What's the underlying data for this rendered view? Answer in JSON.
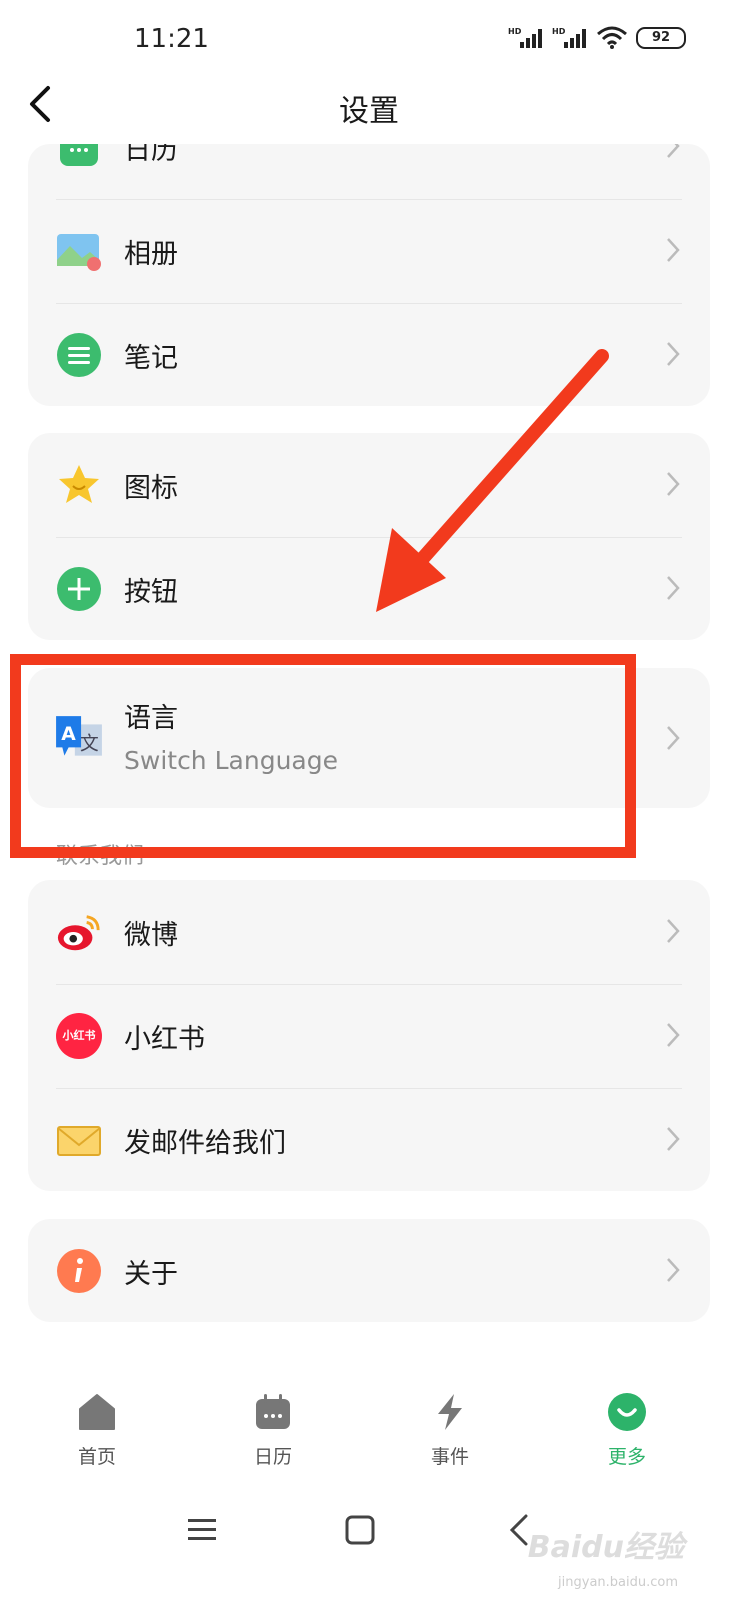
{
  "status_bar": {
    "time": "11:21",
    "signal_label_1": "HD",
    "signal_label_2": "HD",
    "battery": "92"
  },
  "header": {
    "title": "设置"
  },
  "section1": {
    "items": [
      {
        "label": "日历",
        "icon": "calendar-app-icon"
      },
      {
        "label": "相册",
        "icon": "photo-album-icon"
      },
      {
        "label": "笔记",
        "icon": "notes-icon"
      }
    ]
  },
  "section2": {
    "items": [
      {
        "label": "图标",
        "icon": "star-icon"
      },
      {
        "label": "按钮",
        "icon": "plus-circle-icon"
      }
    ]
  },
  "language": {
    "title": "语言",
    "subtitle": "Switch Language",
    "icon": "translate-icon"
  },
  "contact": {
    "section_label": "联系我们",
    "items": [
      {
        "label": "微博",
        "icon": "weibo-icon"
      },
      {
        "label": "小红书",
        "icon": "xiaohongshu-icon",
        "icon_text": "小红书"
      },
      {
        "label": "发邮件给我们",
        "icon": "mail-icon"
      }
    ]
  },
  "about": {
    "label": "关于",
    "icon": "info-icon"
  },
  "tabs": [
    {
      "label": "首页",
      "icon": "home-icon",
      "active": false
    },
    {
      "label": "日历",
      "icon": "calendar-icon",
      "active": false
    },
    {
      "label": "事件",
      "icon": "lightning-icon",
      "active": false
    },
    {
      "label": "更多",
      "icon": "more-smile-icon",
      "active": true
    }
  ],
  "watermark": {
    "text": "Baidu经验",
    "sub": "jingyan.baidu.com"
  },
  "colors": {
    "accent_green": "#2db36a",
    "annotation_red": "#f23a1d",
    "card_bg": "#f6f6f6"
  }
}
